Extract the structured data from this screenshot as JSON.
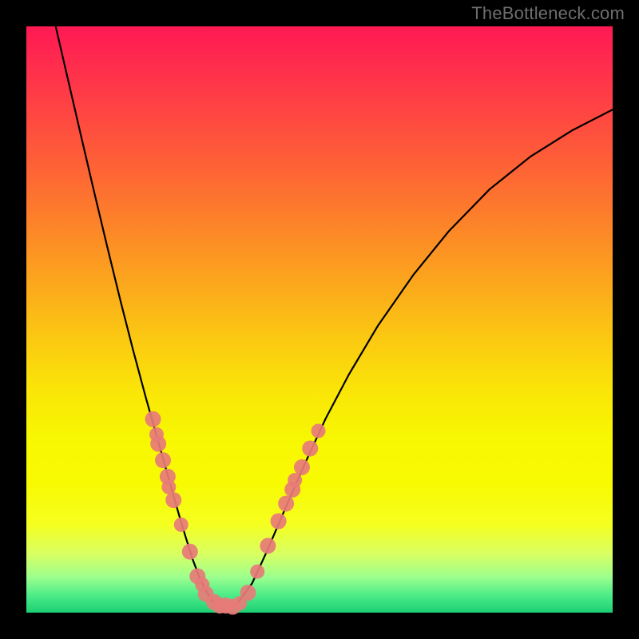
{
  "watermark": "TheBottleneck.com",
  "colors": {
    "curve": "#000000",
    "dot_fill": "#e77b78",
    "dot_stroke": "#b94e49",
    "black_frame": "#000000"
  },
  "chart_data": {
    "type": "line",
    "title": "",
    "xlabel": "",
    "ylabel": "",
    "xlim": [
      0,
      1
    ],
    "ylim": [
      0,
      1
    ],
    "series": [
      {
        "name": "curve",
        "x": [
          0.05,
          0.072,
          0.094,
          0.116,
          0.138,
          0.16,
          0.182,
          0.204,
          0.226,
          0.248,
          0.26,
          0.272,
          0.284,
          0.296,
          0.308,
          0.32,
          0.34,
          0.36,
          0.385,
          0.41,
          0.44,
          0.475,
          0.51,
          0.55,
          0.6,
          0.66,
          0.72,
          0.79,
          0.86,
          0.93,
          1.0
        ],
        "y": [
          1.0,
          0.905,
          0.81,
          0.716,
          0.624,
          0.534,
          0.448,
          0.366,
          0.288,
          0.21,
          0.168,
          0.128,
          0.09,
          0.058,
          0.034,
          0.016,
          0.004,
          0.016,
          0.05,
          0.104,
          0.174,
          0.254,
          0.33,
          0.406,
          0.49,
          0.576,
          0.65,
          0.722,
          0.778,
          0.822,
          0.858
        ]
      }
    ],
    "scatter_points": {
      "name": "dots",
      "points": [
        {
          "x": 0.216,
          "y": 0.33,
          "r": 10
        },
        {
          "x": 0.222,
          "y": 0.304,
          "r": 9
        },
        {
          "x": 0.225,
          "y": 0.288,
          "r": 10
        },
        {
          "x": 0.233,
          "y": 0.26,
          "r": 10
        },
        {
          "x": 0.241,
          "y": 0.232,
          "r": 10
        },
        {
          "x": 0.243,
          "y": 0.214,
          "r": 9
        },
        {
          "x": 0.251,
          "y": 0.192,
          "r": 10
        },
        {
          "x": 0.264,
          "y": 0.15,
          "r": 9
        },
        {
          "x": 0.279,
          "y": 0.104,
          "r": 10
        },
        {
          "x": 0.292,
          "y": 0.062,
          "r": 10
        },
        {
          "x": 0.3,
          "y": 0.048,
          "r": 9
        },
        {
          "x": 0.306,
          "y": 0.032,
          "r": 10
        },
        {
          "x": 0.32,
          "y": 0.018,
          "r": 10
        },
        {
          "x": 0.33,
          "y": 0.012,
          "r": 10
        },
        {
          "x": 0.34,
          "y": 0.012,
          "r": 10
        },
        {
          "x": 0.352,
          "y": 0.01,
          "r": 10
        },
        {
          "x": 0.364,
          "y": 0.016,
          "r": 9
        },
        {
          "x": 0.378,
          "y": 0.034,
          "r": 10
        },
        {
          "x": 0.394,
          "y": 0.07,
          "r": 9
        },
        {
          "x": 0.412,
          "y": 0.114,
          "r": 10
        },
        {
          "x": 0.43,
          "y": 0.156,
          "r": 10
        },
        {
          "x": 0.443,
          "y": 0.186,
          "r": 10
        },
        {
          "x": 0.454,
          "y": 0.21,
          "r": 10
        },
        {
          "x": 0.458,
          "y": 0.226,
          "r": 9
        },
        {
          "x": 0.47,
          "y": 0.248,
          "r": 10
        },
        {
          "x": 0.484,
          "y": 0.28,
          "r": 10
        },
        {
          "x": 0.498,
          "y": 0.31,
          "r": 9
        }
      ]
    }
  }
}
